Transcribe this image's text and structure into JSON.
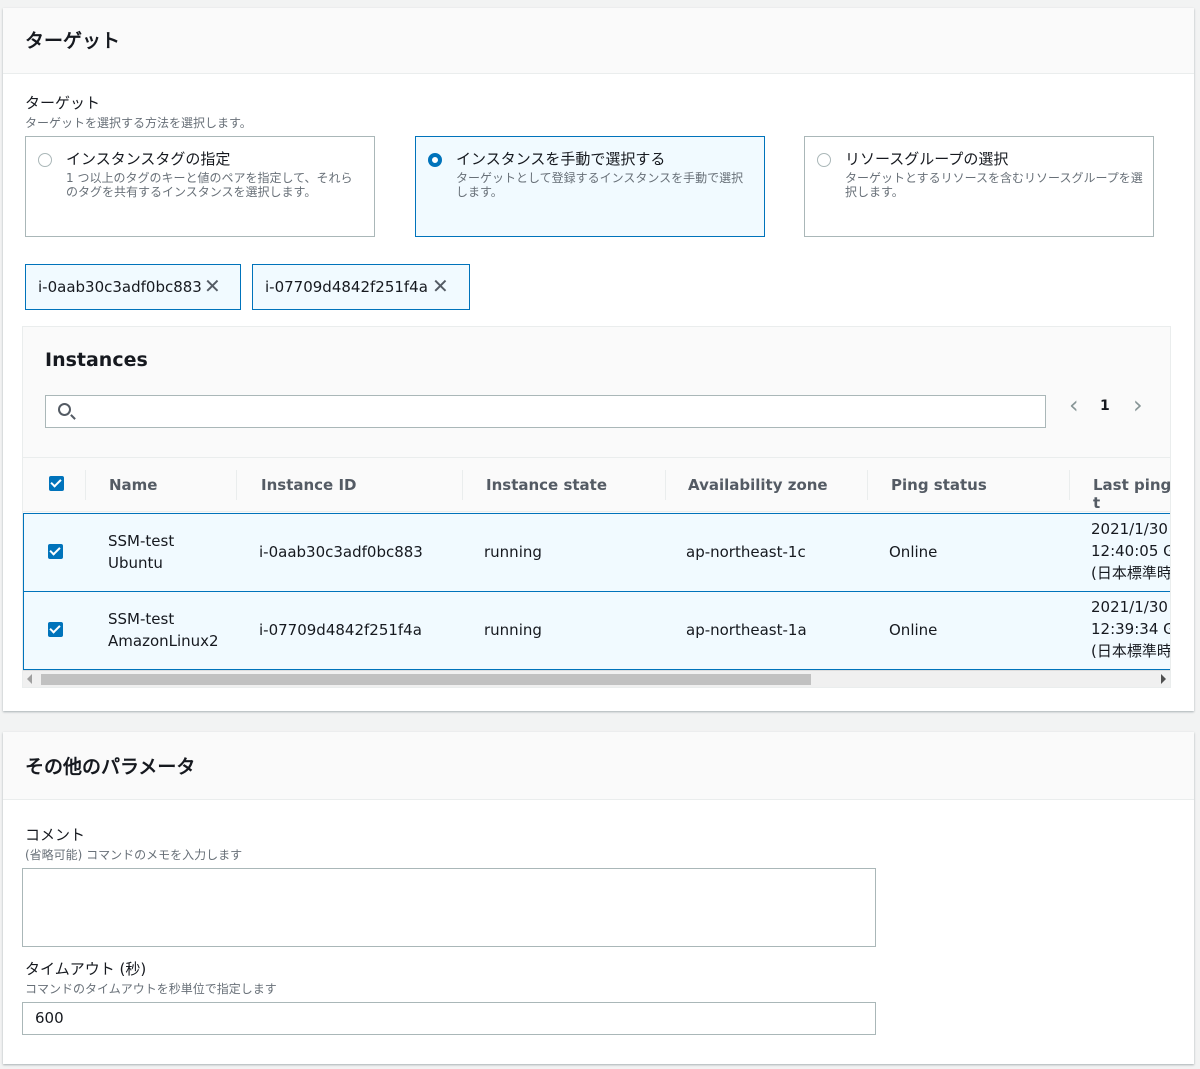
{
  "targets": {
    "title": "ターゲット",
    "field_label": "ターゲット",
    "field_desc": "ターゲットを選択する方法を選択します。",
    "options": [
      {
        "title": "インスタンスタグの指定",
        "desc": "1 つ以上のタグのキーと値のペアを指定して、それらのタグを共有するインスタンスを選択します。",
        "selected": false
      },
      {
        "title": "インスタンスを手動で選択する",
        "desc": "ターゲットとして登録するインスタンスを手動で選択します。",
        "selected": true
      },
      {
        "title": "リソースグループの選択",
        "desc": "ターゲットとするリソースを含むリソースグループを選択します。",
        "selected": false
      }
    ],
    "tokens": [
      "i-0aab30c3adf0bc883",
      "i-07709d4842f251f4a"
    ],
    "token_remove_glyph": "✕"
  },
  "instances": {
    "title": "Instances",
    "search_placeholder": "",
    "pager": {
      "prev": "‹",
      "page": "1",
      "next": "›"
    },
    "columns": [
      "Name",
      "Instance ID",
      "Instance state",
      "Availability zone",
      "Ping status",
      "Last ping t"
    ],
    "rows": [
      {
        "name": [
          "SSM-test",
          "Ubuntu"
        ],
        "instance_id": "i-0aab30c3adf0bc883",
        "state": "running",
        "az": "ap-northeast-1c",
        "ping": "Online",
        "last_ping": [
          "2021/1/30",
          "12:40:05 G",
          "(日本標準時"
        ],
        "checked": true
      },
      {
        "name": [
          "SSM-test",
          "AmazonLinux2"
        ],
        "instance_id": "i-07709d4842f251f4a",
        "state": "running",
        "az": "ap-northeast-1a",
        "ping": "Online",
        "last_ping": [
          "2021/1/30",
          "12:39:34 G",
          "(日本標準時"
        ],
        "checked": true
      }
    ]
  },
  "other_params": {
    "title": "その他のパラメータ",
    "comment_label": "コメント",
    "comment_desc": "(省略可能) コマンドのメモを入力します",
    "comment_value": "",
    "timeout_label": "タイムアウト (秒)",
    "timeout_desc": "コマンドのタイムアウトを秒単位で指定します",
    "timeout_value": "600"
  },
  "colors": {
    "accent": "#0073bb",
    "selected_bg": "#f1faff",
    "border": "#aab7b8"
  }
}
